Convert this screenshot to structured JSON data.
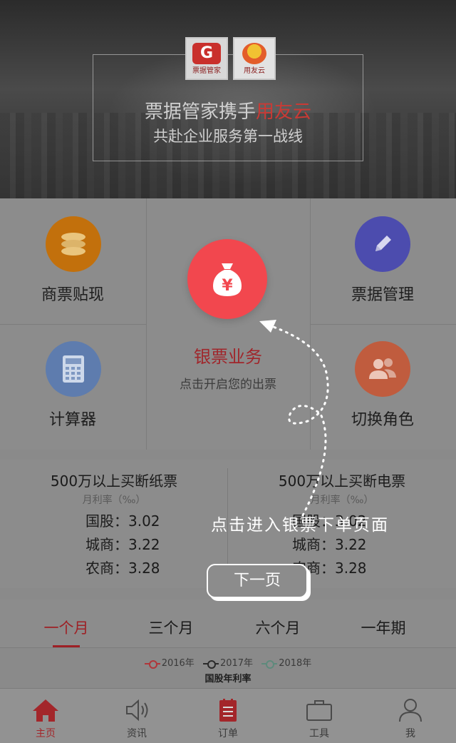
{
  "banner": {
    "logo_left_caption": "票据管家",
    "logo_right_caption": "用友云",
    "title_main": "票据管家携手",
    "title_highlight": "用友云",
    "subtitle": "共赴企业服务第一战线"
  },
  "tiles": {
    "discount": "商票贴现",
    "bill_manage": "票据管理",
    "calculator": "计算器",
    "switch_role": "切换角色"
  },
  "center": {
    "title": "银票业务",
    "subtitle": "点击开启您的出票"
  },
  "rates": {
    "left": {
      "title": "500万以上买断纸票",
      "sub": "月利率（‰）",
      "rows": [
        "国股：3.02",
        "城商：3.22",
        "农商：3.28"
      ]
    },
    "right": {
      "title": "500万以上买断电票",
      "sub": "月利率（‰）",
      "rows": [
        "国股：3.02",
        "城商：3.22",
        "农商：3.28"
      ]
    }
  },
  "periods": [
    "一个月",
    "三个月",
    "六个月",
    "一年期"
  ],
  "chart": {
    "legend": [
      "2016年",
      "2017年",
      "2018年"
    ],
    "legend_colors": [
      "#b0363a",
      "#2a2a2a",
      "#5e8a7c"
    ],
    "title": "国股年利率"
  },
  "overlay": {
    "hint": "点击进入银票下单页面",
    "next": "下一页"
  },
  "nav": [
    "主页",
    "资讯",
    "订单",
    "工具",
    "我"
  ],
  "colors": {
    "accent": "#f2474e",
    "brand_red": "#a3262a",
    "discount_icon": "#e7860e",
    "bill_icon": "#5b5bd6",
    "calc_icon": "#6f93d0",
    "role_icon": "#e0704c"
  }
}
